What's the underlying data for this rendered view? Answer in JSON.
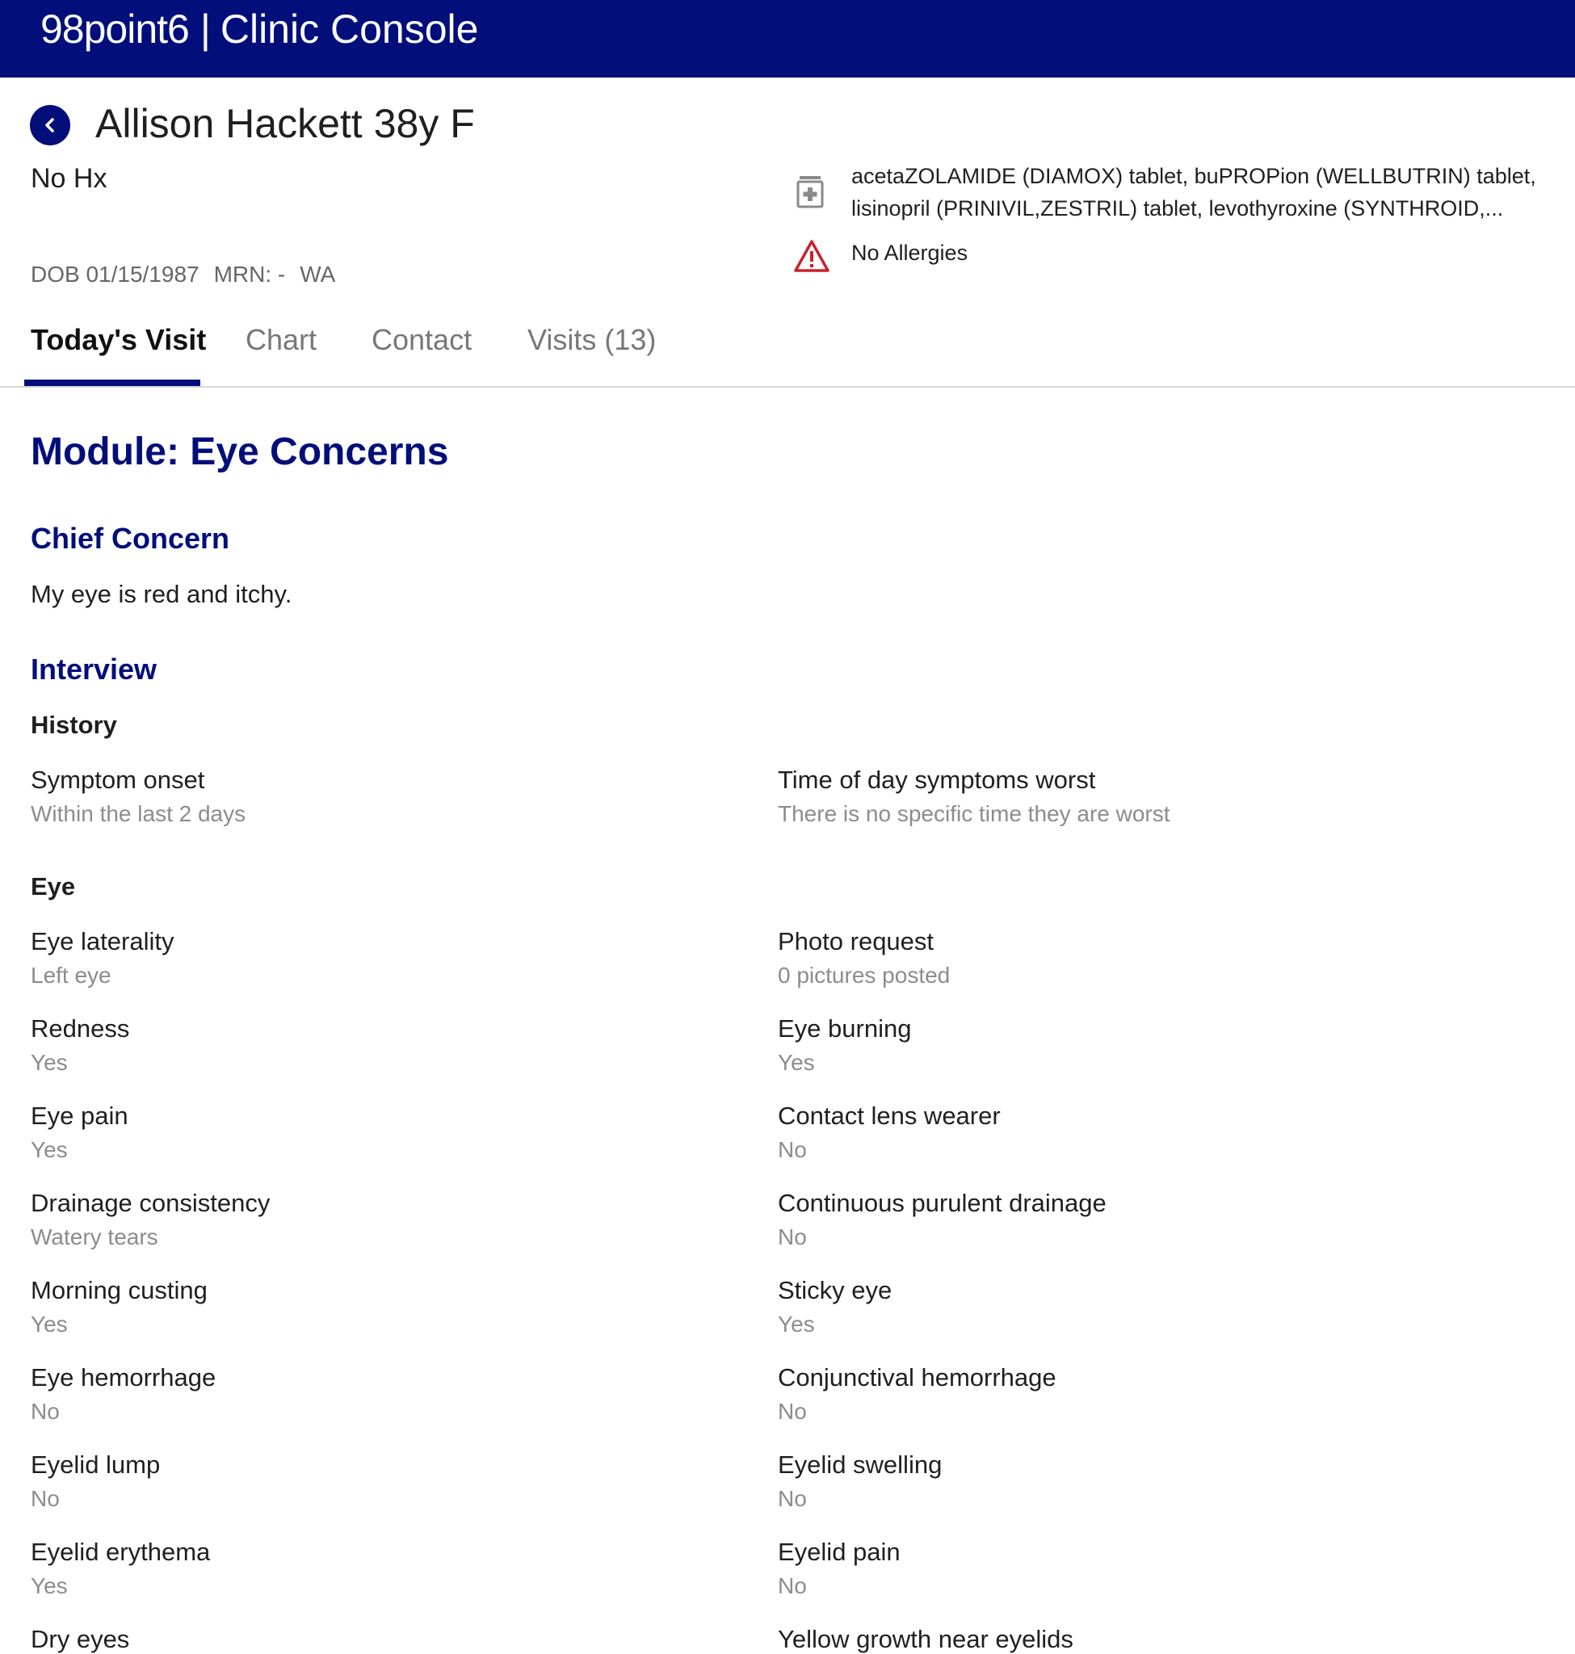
{
  "header": {
    "logo": "98point6",
    "separator": "|",
    "app_title": "Clinic Console",
    "bar_color": "#020e7a"
  },
  "patient": {
    "back_icon": "chevron-left-icon",
    "name": "Allison Hackett",
    "age_sex": "38y F",
    "history": "No Hx",
    "dob": "DOB 01/15/1987",
    "mrn": "MRN: -",
    "state": "WA",
    "medications_icon": "pill-bottle-icon",
    "medications_line1": "acetaZOLAMIDE (DIAMOX) tablet, buPROPion (WELLBUTRIN) tablet,",
    "medications_line2": "lisinopril (PRINIVIL,ZESTRIL) tablet, levothyroxine (SYNTHROID,...",
    "allergy_icon": "warning-triangle-icon",
    "allergies": "No Allergies"
  },
  "tabs": [
    {
      "label": "Today's Visit",
      "active": true
    },
    {
      "label": "Chart",
      "active": false
    },
    {
      "label": "Contact",
      "active": false
    },
    {
      "label": "Visits (13)",
      "active": false
    }
  ],
  "module": {
    "title": "Module: Eye Concerns",
    "chief_concern_heading": "Chief Concern",
    "chief_concern_text": "My eye is red and itchy.",
    "interview_heading": "Interview",
    "history_heading": "History",
    "history_items": [
      {
        "question": "Symptom onset",
        "answer": "Within the last 2 days"
      },
      {
        "question": "Time of day symptoms worst",
        "answer": "There is no specific time they are worst"
      }
    ],
    "eye_heading": "Eye",
    "eye_items": [
      {
        "question": "Eye laterality",
        "answer": "Left eye"
      },
      {
        "question": "Photo request",
        "answer": "0 pictures posted"
      },
      {
        "question": "Redness",
        "answer": "Yes"
      },
      {
        "question": "Eye burning",
        "answer": "Yes"
      },
      {
        "question": "Eye pain",
        "answer": "Yes"
      },
      {
        "question": "Contact lens wearer",
        "answer": "No"
      },
      {
        "question": "Drainage consistency",
        "answer": "Watery tears"
      },
      {
        "question": "Continuous purulent drainage",
        "answer": "No"
      },
      {
        "question": "Morning custing",
        "answer": "Yes"
      },
      {
        "question": "Sticky eye",
        "answer": "Yes"
      },
      {
        "question": "Eye hemorrhage",
        "answer": "No"
      },
      {
        "question": "Conjunctival hemorrhage",
        "answer": "No"
      },
      {
        "question": "Eyelid lump",
        "answer": "No"
      },
      {
        "question": "Eyelid swelling",
        "answer": "No"
      },
      {
        "question": "Eyelid erythema",
        "answer": "Yes"
      },
      {
        "question": "Eyelid pain",
        "answer": "No"
      },
      {
        "question": "Dry eyes",
        "answer": ""
      },
      {
        "question": "Yellow growth near eyelids",
        "answer": ""
      }
    ]
  }
}
